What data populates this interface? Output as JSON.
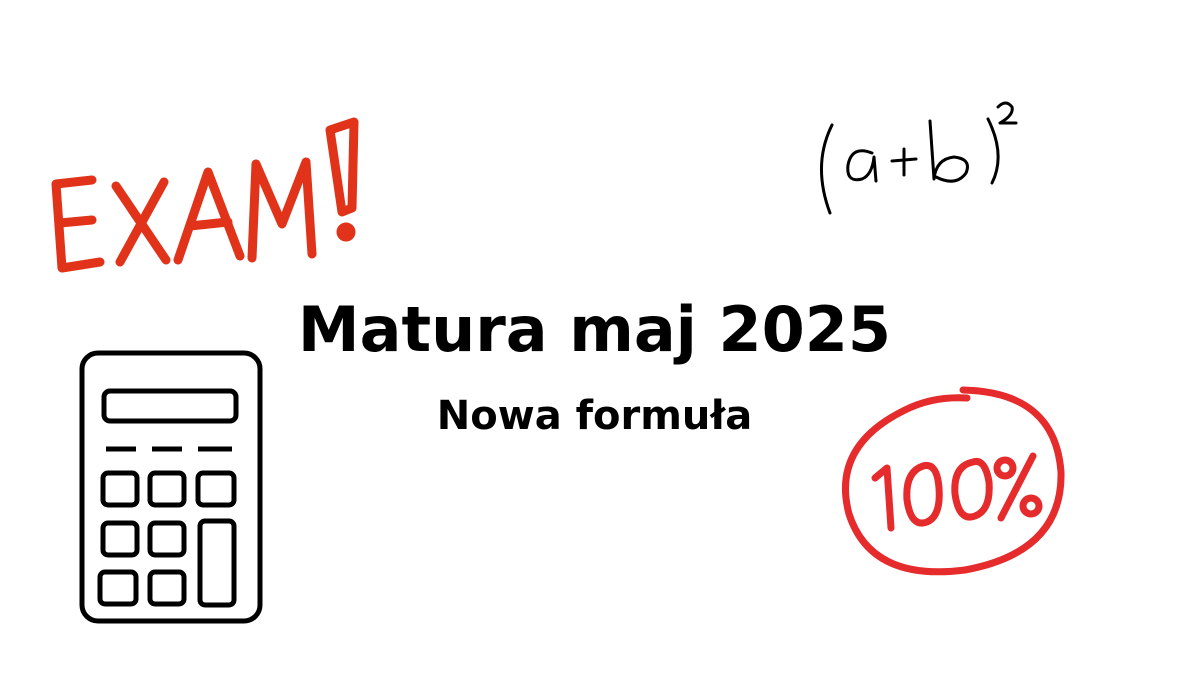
{
  "heading": {
    "title": "Matura maj 2025",
    "subtitle": "Nowa formuła"
  },
  "decorations": {
    "exam_label": "EXAM!",
    "formula_label": "(a+b)²",
    "score_label": "100%",
    "exam_color": "#e0331a",
    "score_color": "#e52b2b",
    "ink_color": "#000000"
  },
  "icons": [
    "calculator-icon",
    "exam-handwritten-text",
    "formula-handwritten-text",
    "hundred-percent-stamp"
  ]
}
